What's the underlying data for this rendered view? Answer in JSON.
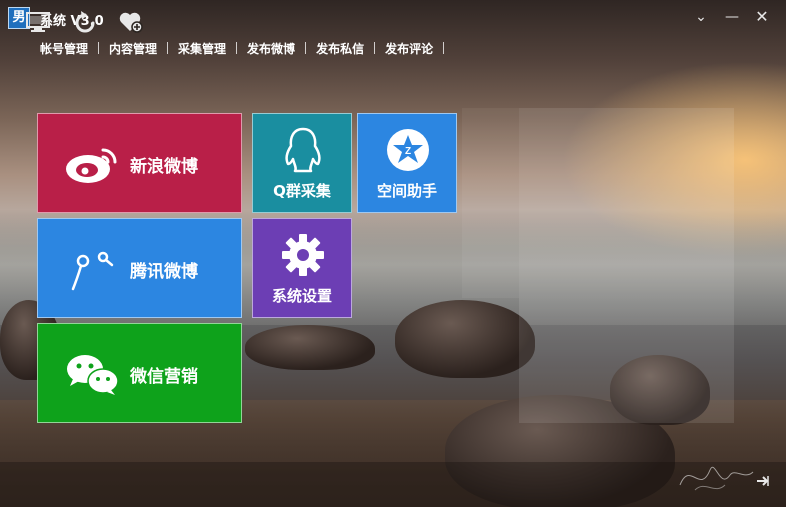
{
  "window": {
    "title": "系统 V3.0",
    "logo_char": "男",
    "controls": {
      "dropdown": "⌄",
      "minimize": "—",
      "close": "✕"
    }
  },
  "menu": [
    "帐号管理",
    "内容管理",
    "采集管理",
    "发布微博",
    "发布私信",
    "发布评论"
  ],
  "tiles": {
    "weibo": {
      "label": "新浪微博",
      "icon": "weibo-icon",
      "color": "#b91f48"
    },
    "tencent": {
      "label": "腾讯微博",
      "icon": "tencent-weibo-icon",
      "color": "#2c86e1"
    },
    "wechat": {
      "label": "微信营销",
      "icon": "wechat-icon",
      "color": "#0ea21b"
    },
    "qgroup": {
      "label": "Q群采集",
      "icon": "qq-penguin-icon",
      "color": "#1a8ea0"
    },
    "qzone": {
      "label": "空间助手",
      "icon": "qzone-star-icon",
      "color": "#2c86e1"
    },
    "settings": {
      "label": "系统设置",
      "icon": "gear-icon",
      "color": "#6c3eb4"
    }
  },
  "bottom_icons": [
    "monitor-icon",
    "refresh-icon",
    "heart-add-icon",
    "exit-icon"
  ]
}
